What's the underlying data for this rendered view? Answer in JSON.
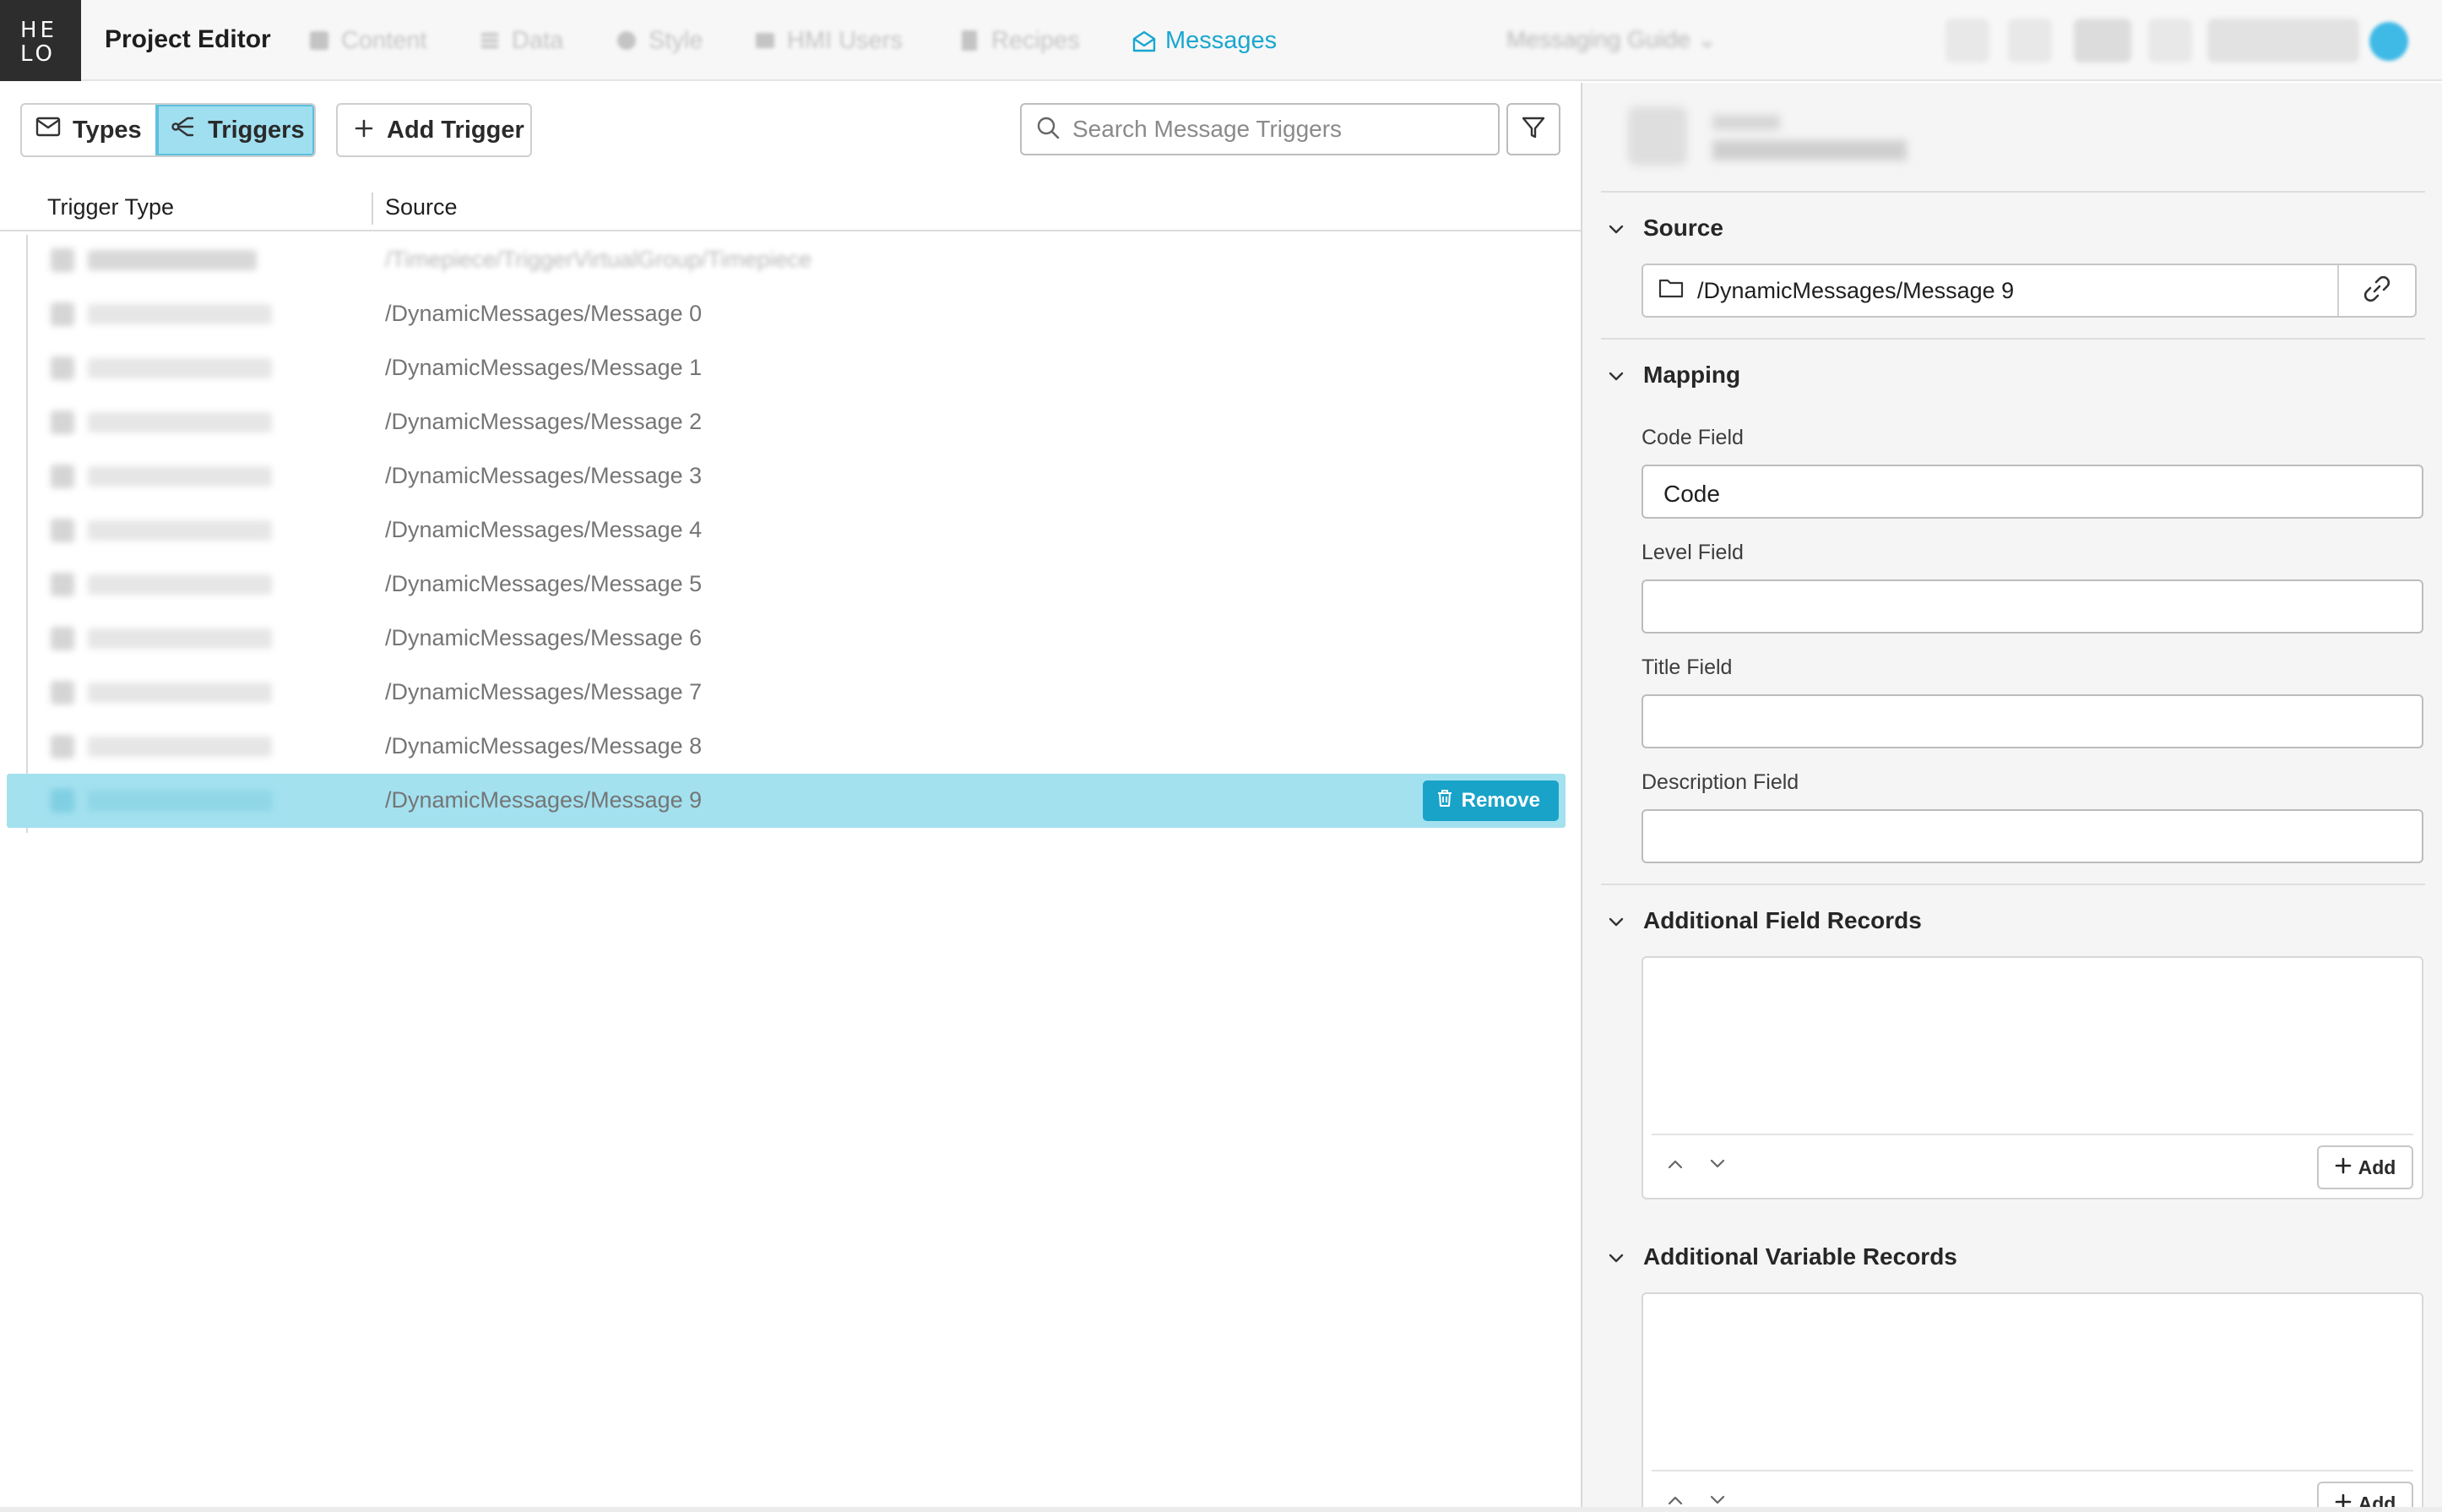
{
  "app": {
    "title": "Project Editor",
    "logo_line1": "HE",
    "logo_line2": "LO"
  },
  "nav": {
    "items": [
      {
        "label": "Content",
        "active": false
      },
      {
        "label": "Data",
        "active": false
      },
      {
        "label": "Style",
        "active": false
      },
      {
        "label": "HMI Users",
        "active": false
      },
      {
        "label": "Recipes",
        "active": false
      },
      {
        "label": "Messages",
        "active": true
      }
    ],
    "guide": "Messaging Guide"
  },
  "toolbar": {
    "types_label": "Types",
    "triggers_label": "Triggers",
    "add_trigger_label": "Add Trigger",
    "search_placeholder": "Search Message Triggers"
  },
  "table": {
    "headers": {
      "trigger_type": "Trigger Type",
      "source": "Source"
    },
    "rows": [
      {
        "source": "/Timepiece/TriggerVirtualGroup/Timepiece"
      },
      {
        "source": "/DynamicMessages/Message 0"
      },
      {
        "source": "/DynamicMessages/Message 1"
      },
      {
        "source": "/DynamicMessages/Message 2"
      },
      {
        "source": "/DynamicMessages/Message 3"
      },
      {
        "source": "/DynamicMessages/Message 4"
      },
      {
        "source": "/DynamicMessages/Message 5"
      },
      {
        "source": "/DynamicMessages/Message 6"
      },
      {
        "source": "/DynamicMessages/Message 7"
      },
      {
        "source": "/DynamicMessages/Message 8"
      },
      {
        "source": "/DynamicMessages/Message 9",
        "selected": true
      }
    ],
    "remove_label": "Remove"
  },
  "detail": {
    "source_section": "Source",
    "source_path": "/DynamicMessages/Message 9",
    "mapping_section": "Mapping",
    "code_field_label": "Code Field",
    "code_field_value": "Code",
    "level_field_label": "Level Field",
    "level_field_value": "",
    "title_field_label": "Title Field",
    "title_field_value": "",
    "description_field_label": "Description Field",
    "description_field_value": "",
    "additional_field_records": "Additional Field Records",
    "additional_variable_records": "Additional Variable Records",
    "add_label": "Add"
  },
  "colors": {
    "accent": "#19a7cf",
    "selected_row": "#a3e1ef",
    "remove_button": "#1aa3c9"
  }
}
